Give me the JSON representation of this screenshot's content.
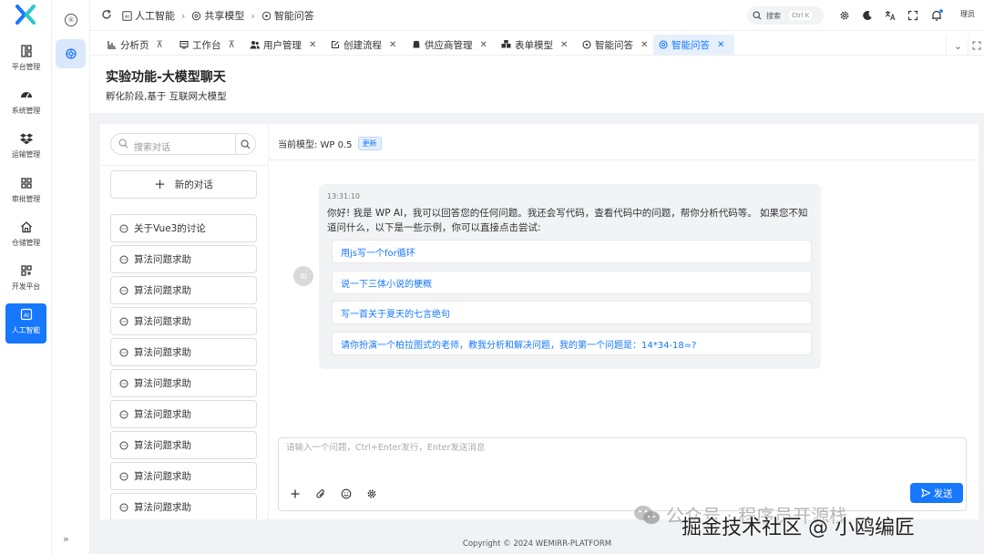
{
  "rail": {
    "items": [
      {
        "label": "平台管理",
        "icon": "platform-icon"
      },
      {
        "label": "系统管理",
        "icon": "dashboard-icon"
      },
      {
        "label": "运输管理",
        "icon": "dropbox-icon"
      },
      {
        "label": "审批管理",
        "icon": "grid-icon"
      },
      {
        "label": "仓储管理",
        "icon": "home-icon"
      },
      {
        "label": "开发平台",
        "icon": "apps-icon"
      },
      {
        "label": "人工智能",
        "icon": "ai-icon",
        "active": true
      }
    ]
  },
  "header": {
    "breadcrumb": [
      "人工智能",
      "共享模型",
      "智能问答"
    ],
    "search_label": "搜索",
    "search_shortcut": "Ctrl K",
    "user_label": "理员"
  },
  "tabs": [
    {
      "label": "分析页",
      "closer": "pin"
    },
    {
      "label": "工作台",
      "closer": "pin"
    },
    {
      "label": "用户管理",
      "closer": "close"
    },
    {
      "label": "创建流程",
      "closer": "close"
    },
    {
      "label": "供应商管理",
      "closer": "close"
    },
    {
      "label": "表单模型",
      "closer": "close"
    },
    {
      "label": "智能问答",
      "closer": "close"
    },
    {
      "label": "智能问答",
      "closer": "close",
      "active": true
    }
  ],
  "page": {
    "title": "实验功能-大模型聊天",
    "subtitle": "孵化阶段,基于 互联网大模型"
  },
  "conversations": {
    "search_placeholder": "搜索对话",
    "new_chat_label": "新的对话",
    "items": [
      "关于Vue3的讨论",
      "算法问题求助",
      "算法问题求助",
      "算法问题求助",
      "算法问题求助",
      "算法问题求助",
      "算法问题求助",
      "算法问题求助",
      "算法问题求助",
      "算法问题求助"
    ]
  },
  "chat": {
    "model_label": "当前模型: WP 0.5",
    "update_label": "更新",
    "avatar_label": "AI",
    "message_time": "13:31:10",
    "message_text": "你好! 我是 WP AI，我可以回答您的任何问题。我还会写代码，查看代码中的问题，帮你分析代码等。 如果您不知道问什么，以下是一些示例，你可以直接点击尝试:",
    "suggestions": [
      "用js写一个for循环",
      "说一下三体小说的梗概",
      "写一首关于夏天的七言绝句",
      "请你扮演一个柏拉图式的老师，教我分析和解决问题，我的第一个问题是：14*34-18=?"
    ],
    "input_placeholder": "请输入一个问题，Ctrl+Enter发行，Enter发送消息",
    "send_label": "发送"
  },
  "footer": {
    "copyright": "Copyright © 2024 WEMIRR-PLATFORM"
  },
  "watermark": {
    "line1": "公众号 · 程序员开源栈",
    "line2": "掘金技术社区 @ 小鸥编匠"
  },
  "colors": {
    "accent": "#1677ff",
    "active_tab_bg": "#e6f0fd"
  }
}
